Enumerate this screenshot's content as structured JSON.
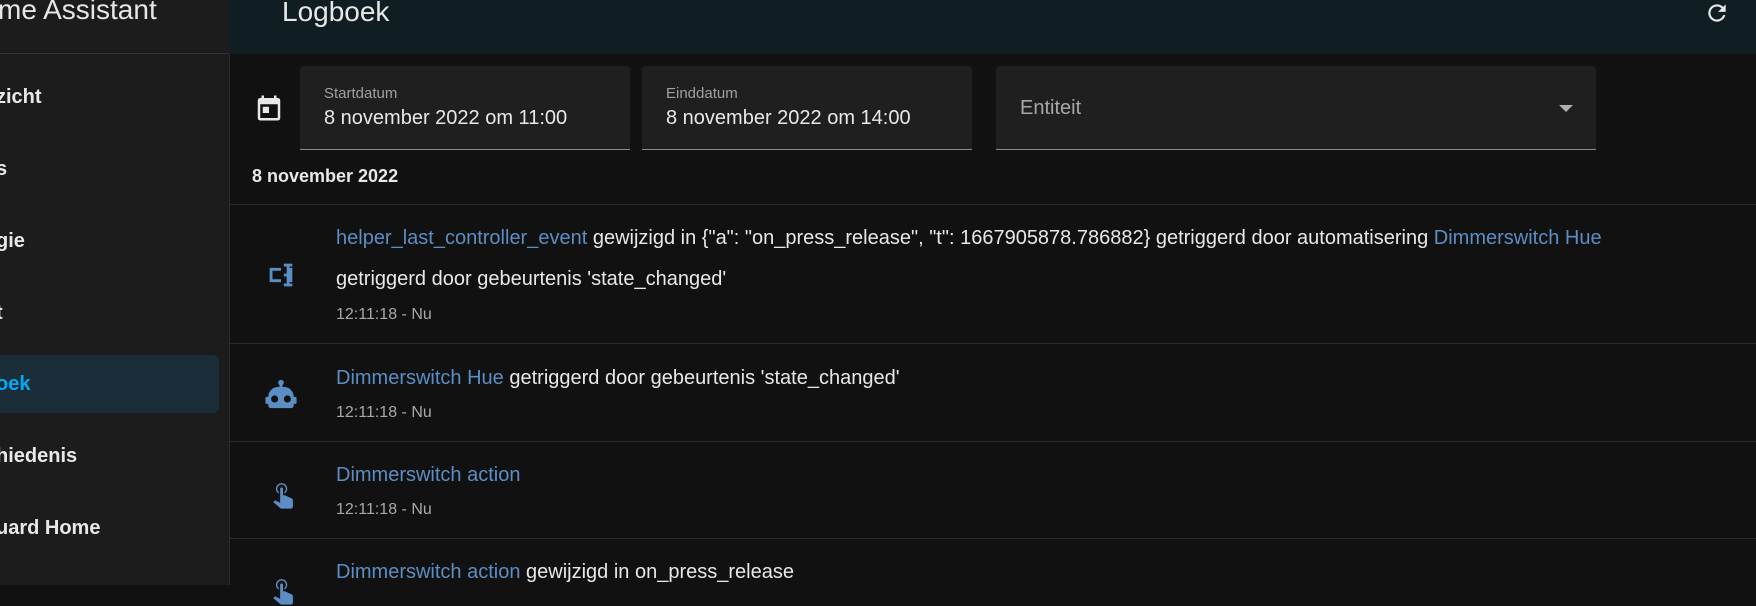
{
  "sidebar": {
    "title": "me Assistant",
    "items": [
      {
        "label": "zicht"
      },
      {
        "label": "s"
      },
      {
        "label": "gie"
      },
      {
        "label": "t"
      },
      {
        "label": "oek"
      },
      {
        "label": "hiedenis"
      },
      {
        "label": "uard Home"
      }
    ],
    "active_index": 4,
    "accent_color": "#03a9f4"
  },
  "header": {
    "title": "Logboek",
    "refresh_icon": "refresh-icon"
  },
  "filters": {
    "calendar_icon": "calendar-icon",
    "start": {
      "label": "Startdatum",
      "value": "8 november 2022 om 11:00"
    },
    "end": {
      "label": "Einddatum",
      "value": "8 november 2022 om 14:00"
    },
    "entity": {
      "placeholder": "Entiteit"
    }
  },
  "log": {
    "date_heading": "8 november 2022",
    "link_color": "#5b8ec4",
    "entries": [
      {
        "icon": "counter-icon",
        "entity": "helper_last_controller_event",
        "text": " gewijzigd in {\"a\": \"on_press_release\", \"t\": 1667905878.786882} getriggerd door automatisering ",
        "link2": "Dimmerswitch Hue",
        "line2": "getriggerd door gebeurtenis 'state_changed'",
        "time": "12:11:18 - Nu"
      },
      {
        "icon": "robot-icon",
        "entity": "Dimmerswitch Hue",
        "text": " getriggerd door gebeurtenis 'state_changed'",
        "time": "12:11:18 - Nu"
      },
      {
        "icon": "gesture-tap-icon",
        "entity": "Dimmerswitch action",
        "text": "",
        "time": "12:11:18 - Nu"
      },
      {
        "icon": "gesture-tap-icon",
        "entity": "Dimmerswitch action",
        "text": " gewijzigd in on_press_release"
      }
    ]
  }
}
